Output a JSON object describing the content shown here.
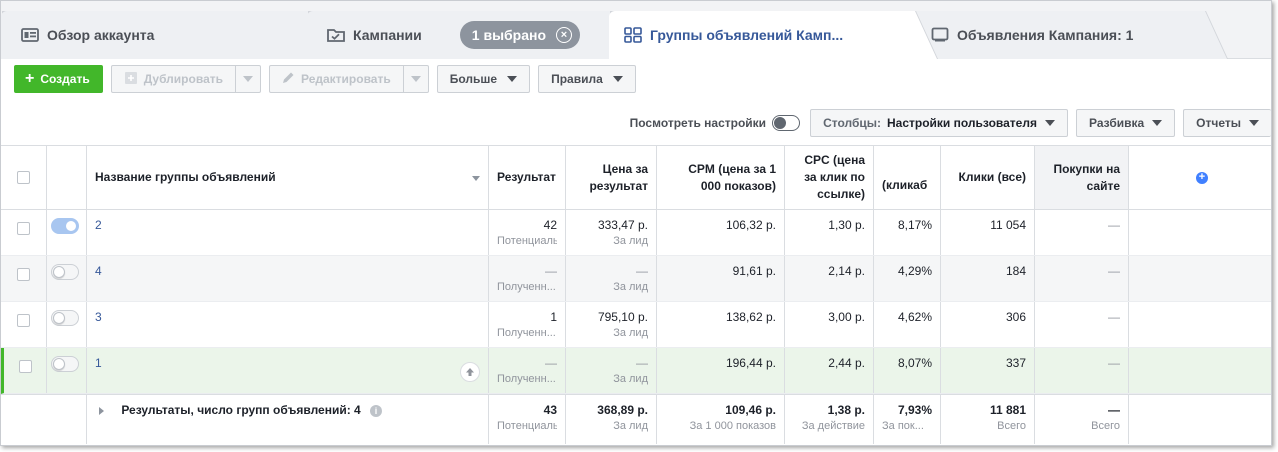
{
  "tabs": [
    {
      "label": "Обзор аккаунта",
      "icon": "account-overview-icon"
    },
    {
      "label": "Кампании",
      "icon": "campaign-folder-icon",
      "pill": "1 выбрано"
    },
    {
      "label": "Группы объявлений Камп...",
      "icon": "ad-sets-grid-icon"
    },
    {
      "label": "Объявления Кампания: 1",
      "icon": "ad-icon"
    }
  ],
  "toolbar": {
    "create": "Создать",
    "duplicate": "Дублировать",
    "edit": "Редактировать",
    "more": "Больше",
    "rules": "Правила"
  },
  "controls": {
    "view_settings": "Посмотреть настройки",
    "columns_prefix": "Столбцы:",
    "columns_value": "Настройки пользователя",
    "breakdown": "Разбивка",
    "reports": "Отчеты"
  },
  "table": {
    "headers": {
      "name": "Название группы объявлений",
      "results": "Результат",
      "cost_per_result": "Цена за результат",
      "cpm": "CPM (цена за 1 000 показов)",
      "cpc": "CPC (цена за клик по ссылке)",
      "ctr": "(кликаб",
      "clicks": "Клики (все)",
      "purchases": "Покупки на сайте"
    },
    "rows": [
      {
        "name": "2",
        "toggle": "on",
        "results": "42",
        "results_sub": "Потенциальн...",
        "cost": "333,47 р.",
        "cost_sub": "За лид",
        "cpm": "106,32 р.",
        "cpc": "1,30 р.",
        "ctr": "8,17%",
        "clicks": "11 054",
        "purchases": "—"
      },
      {
        "name": "4",
        "toggle": "off",
        "results": "—",
        "results_sub": "Полученн...",
        "cost": "—",
        "cost_sub": "За лид",
        "cpm": "91,61 р.",
        "cpc": "2,14 р.",
        "ctr": "4,29%",
        "clicks": "184",
        "purchases": "—"
      },
      {
        "name": "3",
        "toggle": "off",
        "results": "1",
        "results_sub": "Полученн...",
        "cost": "795,10 р.",
        "cost_sub": "За лид",
        "cpm": "138,62 р.",
        "cpc": "3,00 р.",
        "ctr": "4,62%",
        "clicks": "306",
        "purchases": "—"
      },
      {
        "name": "1",
        "toggle": "off",
        "results": "—",
        "results_sub": "Полученн...",
        "cost": "—",
        "cost_sub": "За лид",
        "cpm": "196,44 р.",
        "cpc": "2,44 р.",
        "ctr": "8,07%",
        "clicks": "337",
        "purchases": "—"
      }
    ],
    "footer": {
      "label": "Результаты, число групп объявлений: 4",
      "results": "43",
      "results_sub": "Потенциальн...",
      "cost": "368,89 р.",
      "cost_sub": "За лид",
      "cpm": "109,46 р.",
      "cpm_sub": "За 1 000 показов",
      "cpc": "1,38 р.",
      "cpc_sub": "За действие",
      "ctr": "7,93%",
      "ctr_sub": "За пок...",
      "clicks": "11 881",
      "clicks_sub": "Всего",
      "purchases": "—",
      "purchases_sub": "Всего"
    }
  },
  "colors": {
    "primary_green": "#42b72a",
    "link_blue": "#365899",
    "selected_row_bg": "#ebf5ea",
    "selected_row_marker": "#42b72a"
  }
}
